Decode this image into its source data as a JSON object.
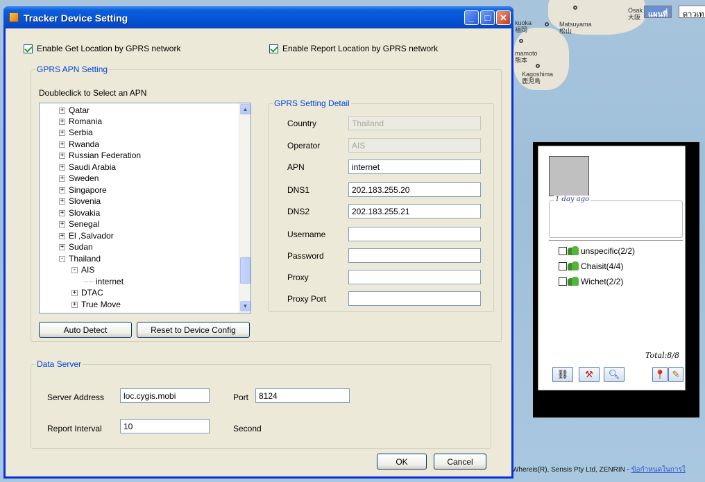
{
  "dialog": {
    "title": "Tracker Device Setting",
    "enable_get_location": "Enable Get Location by GPRS network",
    "enable_report_location": "Enable Report Location by GPRS network",
    "apn_group_title": "GPRS APN Setting",
    "apn_hint": "Doubleclick to Select an APN",
    "tree_items": [
      {
        "label": "Qatar",
        "expander": "+"
      },
      {
        "label": "Romania",
        "expander": "+"
      },
      {
        "label": "Serbia",
        "expander": "+"
      },
      {
        "label": "Rwanda",
        "expander": "+"
      },
      {
        "label": "Russian Federation",
        "expander": "+"
      },
      {
        "label": "Saudi Arabia",
        "expander": "+"
      },
      {
        "label": "Sweden",
        "expander": "+"
      },
      {
        "label": "Singapore",
        "expander": "+"
      },
      {
        "label": "Slovenia",
        "expander": "+"
      },
      {
        "label": "Slovakia",
        "expander": "+"
      },
      {
        "label": "Senegal",
        "expander": "+"
      },
      {
        "label": "El ,Salvador",
        "expander": "+"
      },
      {
        "label": "Sudan",
        "expander": "+"
      },
      {
        "label": "Thailand",
        "expander": "-"
      },
      {
        "label": "AIS",
        "expander": "-"
      },
      {
        "label": "internet",
        "expander": ""
      },
      {
        "label": "DTAC",
        "expander": "+"
      },
      {
        "label": "True Move",
        "expander": "+"
      }
    ],
    "auto_detect_label": "Auto Detect",
    "reset_label": "Reset to Device Config",
    "detail_group_title": "GPRS Setting Detail",
    "fields": {
      "country": {
        "label": "Country",
        "value": "Thailand"
      },
      "operator": {
        "label": "Operator",
        "value": "AIS"
      },
      "apn": {
        "label": "APN",
        "value": "internet"
      },
      "dns1": {
        "label": "DNS1",
        "value": "202.183.255.20"
      },
      "dns2": {
        "label": "DNS2",
        "value": "202.183.255.21"
      },
      "username": {
        "label": "Username",
        "value": ""
      },
      "password": {
        "label": "Password",
        "value": ""
      },
      "proxy": {
        "label": "Proxy",
        "value": ""
      },
      "proxy_port": {
        "label": "Proxy Port",
        "value": ""
      }
    },
    "data_server_title": "Data Server",
    "server_address_label": "Server Address",
    "server_address_value": "loc.cygis.mobi",
    "port_label": "Port",
    "port_value": "8124",
    "report_interval_label": "Report Interval",
    "report_interval_value": "10",
    "second_label": "Second",
    "ok_label": "OK",
    "cancel_label": "Cancel"
  },
  "map": {
    "btn_map": "แผนที่",
    "btn_satellite": "ดาวเท",
    "labels": {
      "osaka": "Osak\n大阪",
      "fukuoka": "kuoka\n福岡",
      "matsuyama": "Matsuyama\n松山",
      "kumamoto": "mamoto\n熊本",
      "kagoshima": "Kagoshima\n鹿児島"
    },
    "copyright": "Whereis(R), Sensis Pty Ltd, ZENRIN - ",
    "terms_link": "ข้อกำหนดในการใ"
  },
  "side_panel": {
    "last_seen": "1 day ago",
    "groups": [
      {
        "label": "unspecific(2/2)"
      },
      {
        "label": "Chaisit(4/4)"
      },
      {
        "label": "Wichet(2/2)"
      }
    ],
    "total": "Total:8/8",
    "tools": [
      "link-icon",
      "tools-icon",
      "search-icon",
      "pin-icon",
      "edit-icon"
    ]
  }
}
